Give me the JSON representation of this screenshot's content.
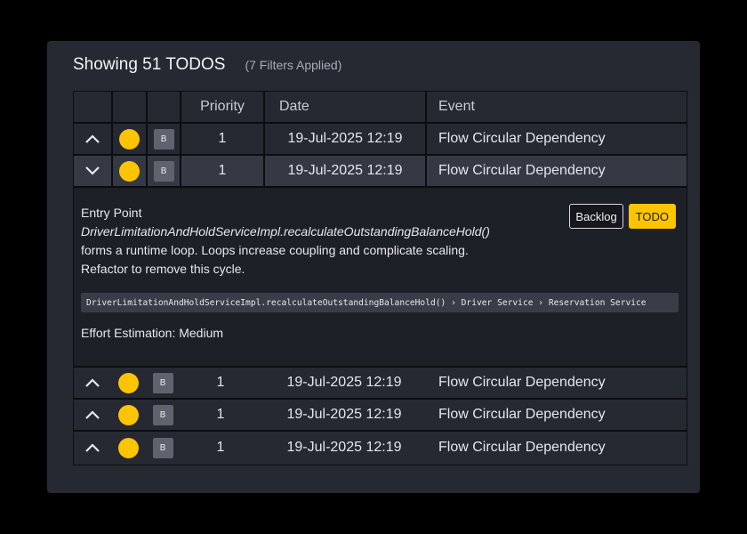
{
  "header": {
    "title": "Showing 51 TODOS",
    "filters": "(7 Filters Applied)"
  },
  "columns": {
    "priority": "Priority",
    "date": "Date",
    "event": "Event"
  },
  "rows": [
    {
      "expanded": false,
      "badge": "B",
      "priority": "1",
      "date": "19-Jul-2025 12:19",
      "event": "Flow Circular Dependency"
    },
    {
      "expanded": true,
      "badge": "B",
      "priority": "1",
      "date": "19-Jul-2025 12:19",
      "event": "Flow Circular Dependency"
    },
    {
      "expanded": false,
      "badge": "B",
      "priority": "1",
      "date": "19-Jul-2025 12:19",
      "event": "Flow Circular Dependency"
    },
    {
      "expanded": false,
      "badge": "B",
      "priority": "1",
      "date": "19-Jul-2025 12:19",
      "event": "Flow Circular Dependency"
    },
    {
      "expanded": false,
      "badge": "B",
      "priority": "1",
      "date": "19-Jul-2025 12:19",
      "event": "Flow Circular Dependency"
    }
  ],
  "detail": {
    "entry_label": "Entry Point",
    "function": "DriverLimitationAndHoldServiceImpl.recalculateOutstandingBalanceHold()",
    "line1": "forms a runtime loop. Loops increase coupling and complicate scaling.",
    "line2": "Refactor to remove this cycle.",
    "path": "DriverLimitationAndHoldServiceImpl.recalculateOutstandingBalanceHold() › Driver Service › Reservation Service",
    "effort": "Effort Estimation: Medium",
    "backlog_label": "Backlog",
    "todo_label": "TODO"
  },
  "colors": {
    "accent": "#ffc400",
    "panel": "#262932",
    "border": "#0c0d10"
  }
}
